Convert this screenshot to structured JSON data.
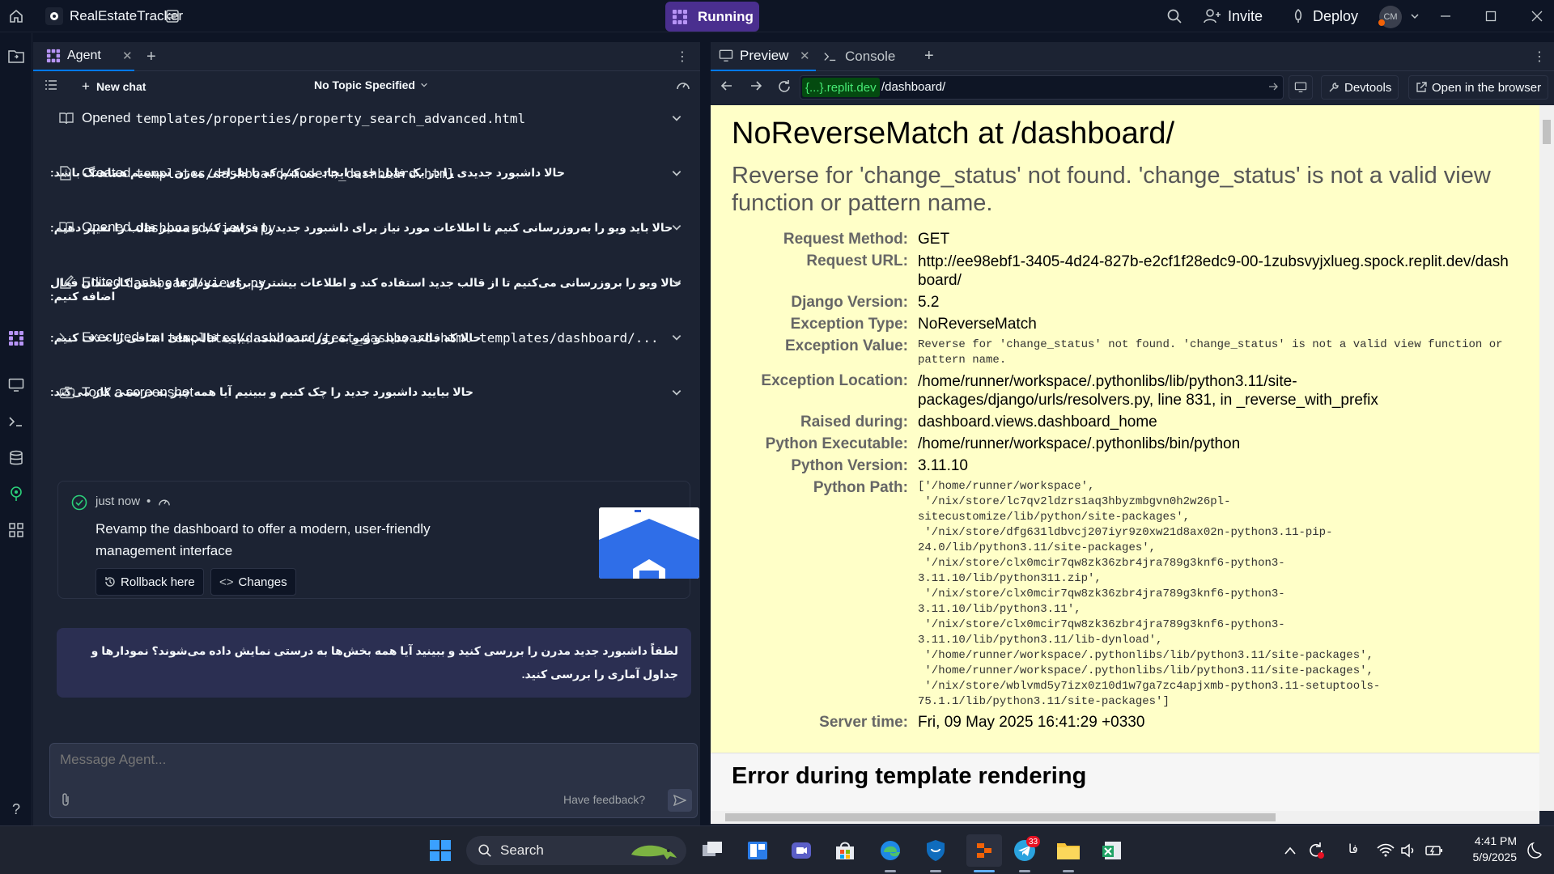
{
  "topbar": {
    "app_name": "RealEstateTracker",
    "run_label": "Running",
    "invite_label": "Invite",
    "deploy_label": "Deploy",
    "avatar_initials": "CM"
  },
  "agent": {
    "tab_label": "Agent",
    "new_chat_label": "New chat",
    "topic_label": "No Topic Specified",
    "actions": [
      {
        "verb": "Opened",
        "path": "templates/properties/property_search_advanced.html",
        "icon": "book-icon"
      },
      {
        "verb": "Created",
        "path": "templates/dashboard/modern_dashboard.html",
        "icon": "file-plus-icon"
      },
      {
        "verb": "Opened",
        "path": "dashboard/views.py",
        "icon": "book-icon"
      },
      {
        "verb": "Edited",
        "path": "dashboard/views.py",
        "icon": "edit-icon"
      },
      {
        "verb": "Executed",
        "path": "rm templates/dashboard/test_dashboard.html templates/dashboard/...",
        "icon": "terminal-icon"
      },
      {
        "verb": "Took a screenshot",
        "path": "",
        "icon": "camera-icon"
      }
    ],
    "notes": [
      "حالا داشبورد جدیدی را در یک فایل جدید ایجاد می‌کنم که با طراحی مدرن سیستم هماهنگ باشد:",
      "حالا باید ویو را به‌روزرسانی کنیم تا اطلاعات مورد نیاز برای داشبورد جدید را فراهم کند و مسیر قالب را تغییر دهیم:",
      "حالا ویو را بروزرسانی می‌کنیم تا از قالب جدید استفاده کند و اطلاعات بیشتری برای نمودارها و بخش کارمندان فعال اضافه کنیم:",
      "حالا که قالب جدید و ویو به روز شده است، بیایید قالب‌های اضافی را حذف کنیم:",
      "حالا بیایید داشبورد جدید را چک کنیم و ببینیم آیا همه چیز به درستی کار می‌کند:"
    ],
    "checkpoint": {
      "time": "just now",
      "separator": "•",
      "message": "Revamp the dashboard to offer a modern, user-friendly management interface",
      "rollback_label": "Rollback here",
      "changes_label": "Changes"
    },
    "user_message": "لطفاً داشبورد جدید مدرن را بررسی کنید و ببینید آیا همه بخش‌ها به درستی نمایش داده می‌شوند؟ نمودارها و جداول آماری را بررسی کنید.",
    "composer": {
      "placeholder": "Message Agent...",
      "feedback_label": "Have feedback?"
    }
  },
  "preview": {
    "tab_label": "Preview",
    "console_label": "Console",
    "url_domain": "{...}",
    "url_domain_suffix": ".replit.dev",
    "url_path": "/dashboard/",
    "devtools_label": "Devtools",
    "open_browser_label": "Open in the browser",
    "page": {
      "title": "NoReverseMatch at /dashboard/",
      "subtitle": "Reverse for 'change_status' not found. 'change_status' is not a valid view function or pattern name.",
      "rows": [
        {
          "label": "Request Method:",
          "value": "GET"
        },
        {
          "label": "Request URL:",
          "value": "http://ee98ebf1-3405-4d24-827b-e2cf1f28edc9-00-1zubsvyjxlueg.spock.replit.dev/dashboard/"
        },
        {
          "label": "Django Version:",
          "value": "5.2"
        },
        {
          "label": "Exception Type:",
          "value": "NoReverseMatch"
        },
        {
          "label": "Exception Value:",
          "value": "Reverse for 'change_status' not found. 'change_status' is not a valid view function or pattern name.",
          "mono": true
        },
        {
          "label": "Exception Location:",
          "value": "/home/runner/workspace/.pythonlibs/lib/python3.11/site-packages/django/urls/resolvers.py, line 831, in _reverse_with_prefix"
        },
        {
          "label": "Raised during:",
          "value": "dashboard.views.dashboard_home"
        },
        {
          "label": "Python Executable:",
          "value": "/home/runner/workspace/.pythonlibs/bin/python"
        },
        {
          "label": "Python Version:",
          "value": "3.11.10"
        },
        {
          "label": "Python Path:",
          "value": "['/home/runner/workspace',\n '/nix/store/lc7qv2ldzrs1aq3hbyzmbgvn0h2w26pl-\nsitecustomize/lib/python/site-packages',\n '/nix/store/dfg631ldbvcj207iyr9z0xw21d8ax02n-python3.11-pip-\n24.0/lib/python3.11/site-packages',\n '/nix/store/clx0mcir7qw8zk36zbr4jra789g3knf6-python3-\n3.11.10/lib/python311.zip',\n '/nix/store/clx0mcir7qw8zk36zbr4jra789g3knf6-python3-\n3.11.10/lib/python3.11',\n '/nix/store/clx0mcir7qw8zk36zbr4jra789g3knf6-python3-\n3.11.10/lib/python3.11/lib-dynload',\n '/home/runner/workspace/.pythonlibs/lib/python3.11/site-packages',\n '/home/runner/workspace/.pythonlibs/lib/python3.11/site-packages',\n '/nix/store/wblvmd5y7izx0z10d1w7ga7zc4apjxmb-python3.11-setuptools-\n75.1.1/lib/python3.11/site-packages']",
          "mono": true
        },
        {
          "label": "Server time:",
          "value": "Fri, 09 May 2025 16:41:29 +0330"
        }
      ],
      "section_title": "Error during template rendering"
    }
  },
  "taskbar": {
    "search_label": "Search",
    "telegram_badge": "33",
    "language": "فا",
    "time": "4:41 PM",
    "date": "5/9/2025"
  }
}
